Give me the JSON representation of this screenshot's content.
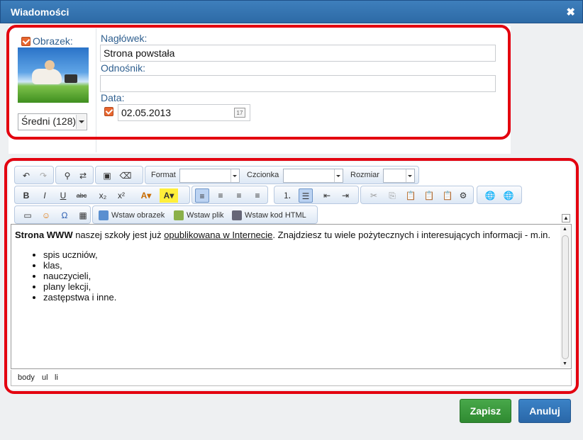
{
  "window": {
    "title": "Wiadomości",
    "close": "✖"
  },
  "image_section": {
    "image_label": "Obrazek:",
    "image_checked": true,
    "size_select": "Średni (128)"
  },
  "fields": {
    "headline_label": "Nagłówek:",
    "headline_value": "Strona powstała",
    "link_label": "Odnośnik:",
    "link_value": "",
    "date_label": "Data:",
    "date_checked": true,
    "date_value": "02.05.2013"
  },
  "toolbar": {
    "format_label": "Format",
    "font_label": "Czcionka",
    "size_label": "Rozmiar",
    "insert_image": "Wstaw obrazek",
    "insert_file": "Wstaw plik",
    "insert_html": "Wstaw kod HTML"
  },
  "editor": {
    "bold_text": "Strona WWW",
    "text_before_link": " naszej szkoły jest już ",
    "link_text": "opublikowana w Internecie",
    "text_after_link": ". Znajdziesz tu wiele pożytecznych i interesujących informacji - m.in.",
    "list": [
      "spis uczniów,",
      "klas,",
      "nauczycieli,",
      "plany lekcji,",
      "zastępstwa i inne."
    ]
  },
  "statusbar": {
    "path": [
      "body",
      "ul",
      "li"
    ]
  },
  "buttons": {
    "save": "Zapisz",
    "cancel": "Anuluj"
  },
  "colors": {
    "accent": "#2d6aa6",
    "highlight": "#e3000f",
    "save": "#3a9a3c",
    "cancel": "#2f74b8"
  }
}
